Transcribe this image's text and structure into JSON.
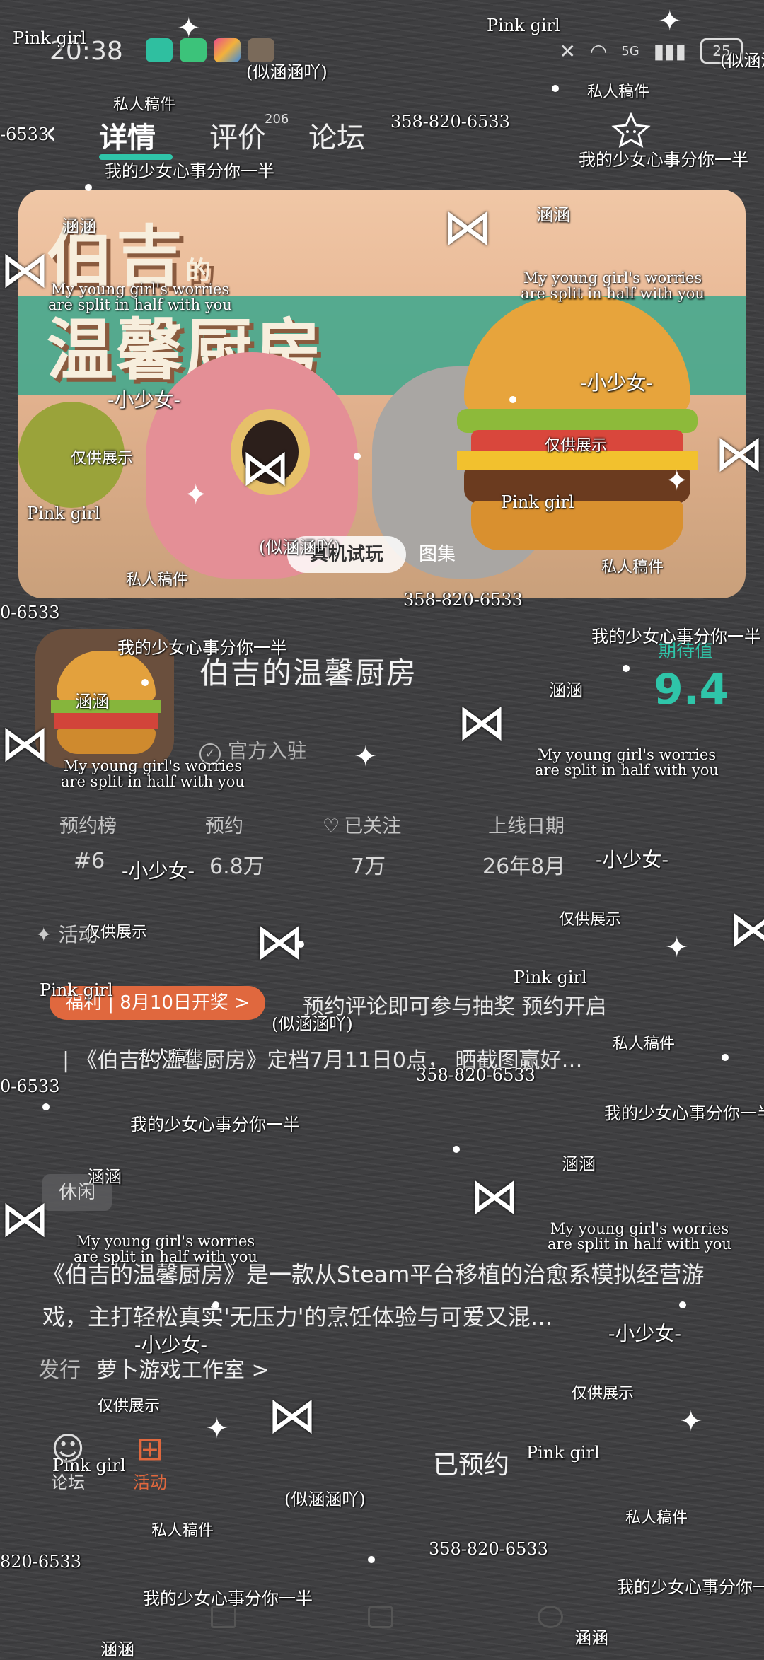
{
  "status_bar": {
    "time": "20:38",
    "signal_text": "5G",
    "battery": "25"
  },
  "nav": {
    "back_icon": "chevron-left",
    "tabs": [
      {
        "label": "详情",
        "active": true
      },
      {
        "label": "评价",
        "count": "206"
      },
      {
        "label": "论坛"
      }
    ]
  },
  "hero": {
    "title_line1": "伯吉",
    "title_small": "的",
    "title_line2": "温馨厨房",
    "try_button": "真机试玩",
    "gallery_button": "图集"
  },
  "app": {
    "name": "伯吉的温馨厨房",
    "official_label": "官方入驻",
    "expect_label": "期待值",
    "expect_score": "9.4"
  },
  "stats": [
    {
      "label": "预约榜",
      "value": "#6"
    },
    {
      "label": "预约",
      "value": "6.8万"
    },
    {
      "label": "已关注",
      "value": "7万"
    },
    {
      "label": "上线日期",
      "value": "26年8月"
    }
  ],
  "activity": {
    "label": "活动"
  },
  "news": {
    "badge": "福利 | 8月10日开奖 >",
    "title": "预约评论即可参与抽奖 预约开启",
    "line": "| 《伯吉的温馨厨房》定档7月11日0点， 晒截图赢好…"
  },
  "tag": "休闲",
  "description": "《伯吉的温馨厨房》是一款从Steam平台移植的治愈系模拟经营游戏，主打轻松真实'无压力'的烹饪体验与可爱又混…",
  "publisher": {
    "label": "发行",
    "name": "萝卜游戏工作室 >"
  },
  "bottom_bar": {
    "forum_label": "论坛",
    "activity_label": "活动",
    "reserved_label": "已预约"
  },
  "watermark": {
    "name": "Pink girl",
    "nick": "(似涵涵吖)",
    "phone": "358-820-6533",
    "private": "私人稿件",
    "heart": "我的少女心事分你一半",
    "hanhan": "涵涵",
    "english1": "My young girl's worries",
    "english2": "are split in half with you",
    "girl": "-小少女-",
    "display": "仅供展示",
    "phone_partial": "-6533",
    "phone_partial2": "0-6533",
    "phone_partial3": "820-6533"
  },
  "colors": {
    "accent": "#2fc5a9",
    "badge": "#e0683e",
    "activity": "#e0683e"
  }
}
